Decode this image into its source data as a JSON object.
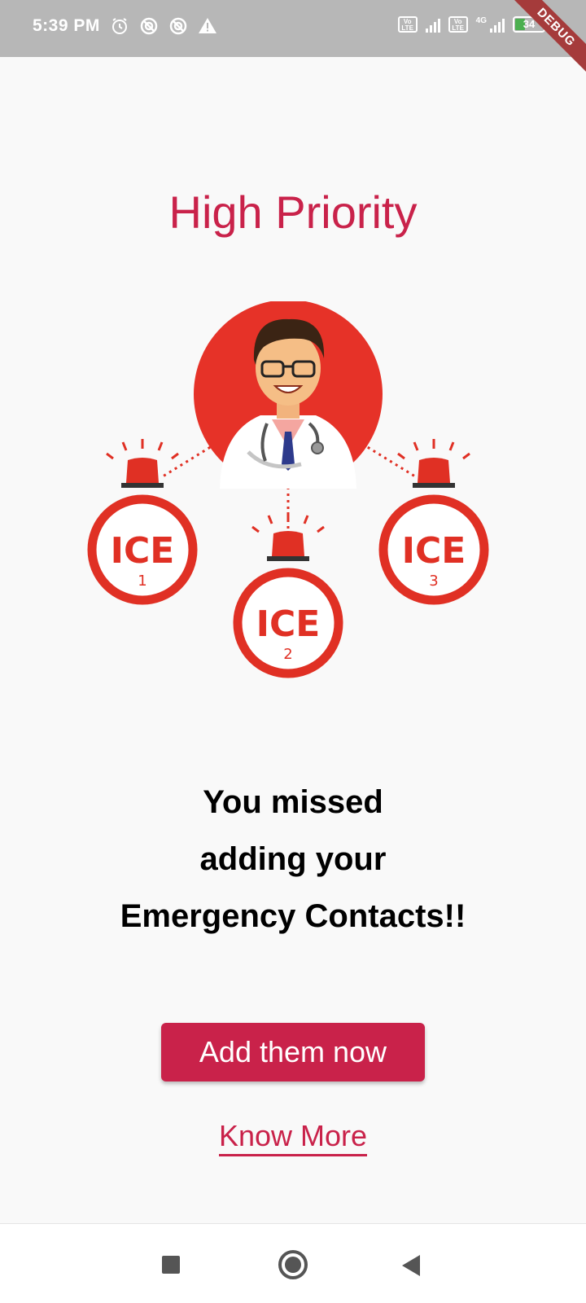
{
  "status_bar": {
    "time": "5:39 PM",
    "left_icons": [
      "alarm-icon",
      "data-saver-icon",
      "data-saver-icon",
      "warning-icon"
    ],
    "volte_label": "Vo LTE",
    "network_label": "4G",
    "battery_percent": "34",
    "battery_level": 0.34
  },
  "debug_banner": "DEBUG",
  "title": "High Priority",
  "illustration": {
    "ice_label": "ICE",
    "contacts": [
      "1",
      "2",
      "3"
    ]
  },
  "message": {
    "line1": "You missed",
    "line2": "adding your",
    "line3": "Emergency Contacts!!"
  },
  "actions": {
    "add_button": "Add them now",
    "know_more": "Know More"
  },
  "colors": {
    "accent": "#c9224a",
    "ice_red": "#e03024",
    "background": "#f9f9f9"
  },
  "nav_bar": {
    "icons": [
      "recents-icon",
      "home-icon",
      "back-icon"
    ]
  }
}
